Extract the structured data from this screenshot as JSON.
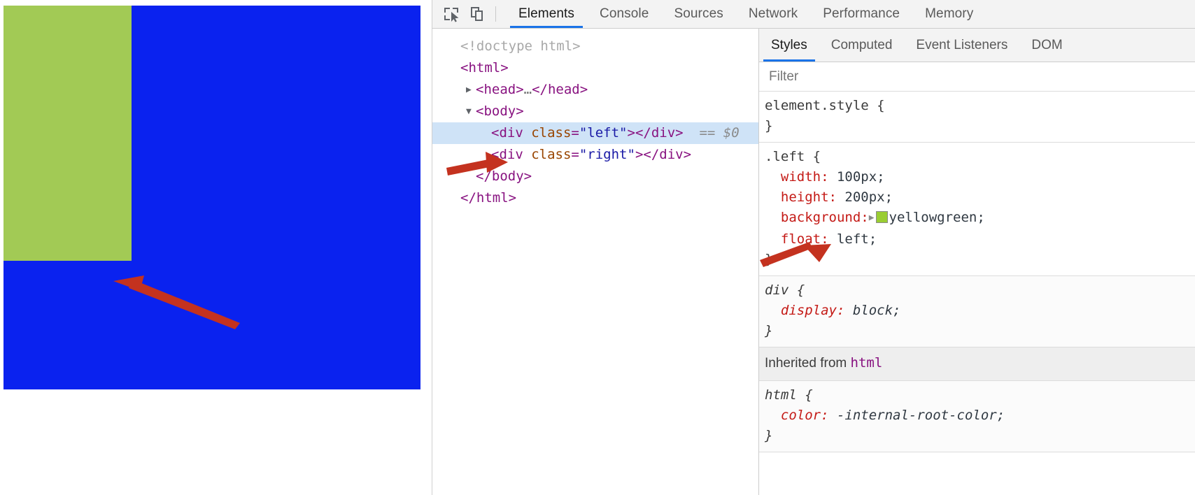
{
  "viewport": {
    "name": "rendered-page-preview",
    "blocks": [
      {
        "name": "left-div",
        "color": "#a2ca55",
        "label": "yellowgreen block"
      },
      {
        "name": "right-div",
        "color": "#0a22ef",
        "label": "blue block"
      }
    ]
  },
  "devtools": {
    "toolbar": {
      "inspect_icon": "inspect-cursor-icon",
      "device_icon": "device-toolbar-icon",
      "tabs": [
        {
          "label": "Elements",
          "active": true
        },
        {
          "label": "Console",
          "active": false
        },
        {
          "label": "Sources",
          "active": false
        },
        {
          "label": "Network",
          "active": false
        },
        {
          "label": "Performance",
          "active": false
        },
        {
          "label": "Memory",
          "active": false
        }
      ]
    },
    "dom_tree": [
      {
        "indent": 0,
        "twisty": "",
        "text_parts": [
          {
            "cls": "doctype",
            "t": "<!doctype html>"
          }
        ]
      },
      {
        "indent": 0,
        "twisty": "",
        "text_parts": [
          {
            "cls": "tag",
            "t": "<html>"
          }
        ]
      },
      {
        "indent": 1,
        "twisty": "▶",
        "text_parts": [
          {
            "cls": "tag",
            "t": "<head>"
          },
          {
            "cls": "ellipsis",
            "t": "…"
          },
          {
            "cls": "tag",
            "t": "</head>"
          }
        ]
      },
      {
        "indent": 1,
        "twisty": "▼",
        "text_parts": [
          {
            "cls": "tag",
            "t": "<body>"
          }
        ]
      },
      {
        "indent": 2,
        "twisty": "",
        "selected": true,
        "text_parts": [
          {
            "cls": "tag",
            "t": "<div "
          },
          {
            "cls": "attr-name",
            "t": "class"
          },
          {
            "cls": "tag",
            "t": "="
          },
          {
            "cls": "attr-val",
            "t": "\"left\""
          },
          {
            "cls": "tag",
            "t": "></div>"
          },
          {
            "cls": "dollar0",
            "t": "  == $0"
          }
        ]
      },
      {
        "indent": 2,
        "twisty": "",
        "text_parts": [
          {
            "cls": "tag",
            "t": "<div "
          },
          {
            "cls": "attr-name",
            "t": "class"
          },
          {
            "cls": "tag",
            "t": "="
          },
          {
            "cls": "attr-val",
            "t": "\"right\""
          },
          {
            "cls": "tag",
            "t": "></div>"
          }
        ]
      },
      {
        "indent": 1,
        "twisty": "",
        "text_parts": [
          {
            "cls": "tag",
            "t": "</body>"
          }
        ]
      },
      {
        "indent": 0,
        "twisty": "",
        "text_parts": [
          {
            "cls": "tag",
            "t": "</html>"
          }
        ]
      }
    ],
    "styles": {
      "tabs": [
        {
          "label": "Styles",
          "active": true
        },
        {
          "label": "Computed",
          "active": false
        },
        {
          "label": "Event Listeners",
          "active": false
        },
        {
          "label": "DOM",
          "active": false
        }
      ],
      "filter_placeholder": "Filter",
      "filter_value": "",
      "rules": [
        {
          "selector": "element.style",
          "ua": false,
          "declarations": []
        },
        {
          "selector": ".left",
          "ua": false,
          "declarations": [
            {
              "prop": "width",
              "value": "100px"
            },
            {
              "prop": "height",
              "value": "200px"
            },
            {
              "prop": "background",
              "value": "yellowgreen",
              "swatch": "#9acd32",
              "expandable": true
            },
            {
              "prop": "float",
              "value": "left"
            }
          ]
        },
        {
          "selector": "div",
          "ua": true,
          "declarations": [
            {
              "prop": "display",
              "value": "block"
            }
          ]
        }
      ],
      "inherited_header": {
        "text": "Inherited from ",
        "source": "html"
      },
      "inherited_rules": [
        {
          "selector": "html",
          "ua": true,
          "declarations": [
            {
              "prop": "color",
              "value": "-internal-root-color"
            }
          ]
        }
      ]
    }
  },
  "annotations": {
    "arrow_color": "#c4321f",
    "arrows": [
      {
        "name": "arrow-pointing-to-blue-block"
      },
      {
        "name": "arrow-pointing-to-selected-dom-node"
      },
      {
        "name": "arrow-pointing-to-float-declaration"
      }
    ]
  }
}
